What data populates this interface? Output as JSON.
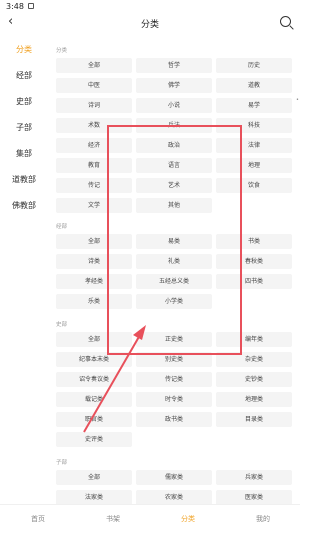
{
  "status_bar": {
    "time": "3:48"
  },
  "header": {
    "back_icon": "chevron-left-icon",
    "title": "分类",
    "search_icon": "search-icon"
  },
  "sidebar": {
    "items": [
      {
        "label": "分类",
        "active": true
      },
      {
        "label": "经部",
        "active": false
      },
      {
        "label": "史部",
        "active": false
      },
      {
        "label": "子部",
        "active": false
      },
      {
        "label": "集部",
        "active": false
      },
      {
        "label": "道教部",
        "active": false
      },
      {
        "label": "佛教部",
        "active": false
      }
    ]
  },
  "sections": [
    {
      "title": "分类",
      "items": [
        "全部",
        "哲学",
        "历史",
        "中医",
        "佛学",
        "道教",
        "诗词",
        "小说",
        "易学",
        "术数",
        "兵法",
        "科技",
        "经济",
        "政治",
        "法律",
        "教育",
        "语言",
        "地理",
        "传记",
        "艺术",
        "饮食",
        "文学",
        "其他"
      ]
    },
    {
      "title": "经部",
      "items": [
        "全部",
        "易类",
        "书类",
        "诗类",
        "礼类",
        "春秋类",
        "孝经类",
        "五经总义类",
        "四书类",
        "乐类",
        "小学类"
      ]
    },
    {
      "title": "史部",
      "items": [
        "全部",
        "正史类",
        "编年类",
        "纪事本末类",
        "别史类",
        "杂史类",
        "诏令奏议类",
        "传记类",
        "史钞类",
        "载记类",
        "时令类",
        "地理类",
        "职官类",
        "政书类",
        "目录类",
        "史评类"
      ]
    },
    {
      "title": "子部",
      "items": [
        "全部",
        "儒家类",
        "兵家类",
        "法家类",
        "农家类",
        "医家类"
      ]
    }
  ],
  "bottom_tabs": [
    {
      "label": "首页",
      "active": false
    },
    {
      "label": "书架",
      "active": false
    },
    {
      "label": "分类",
      "active": true
    },
    {
      "label": "我的",
      "active": false
    }
  ],
  "colors": {
    "accent": "#f0a020",
    "annotation": "#e8505b",
    "chip_bg": "#f4f4f4"
  }
}
